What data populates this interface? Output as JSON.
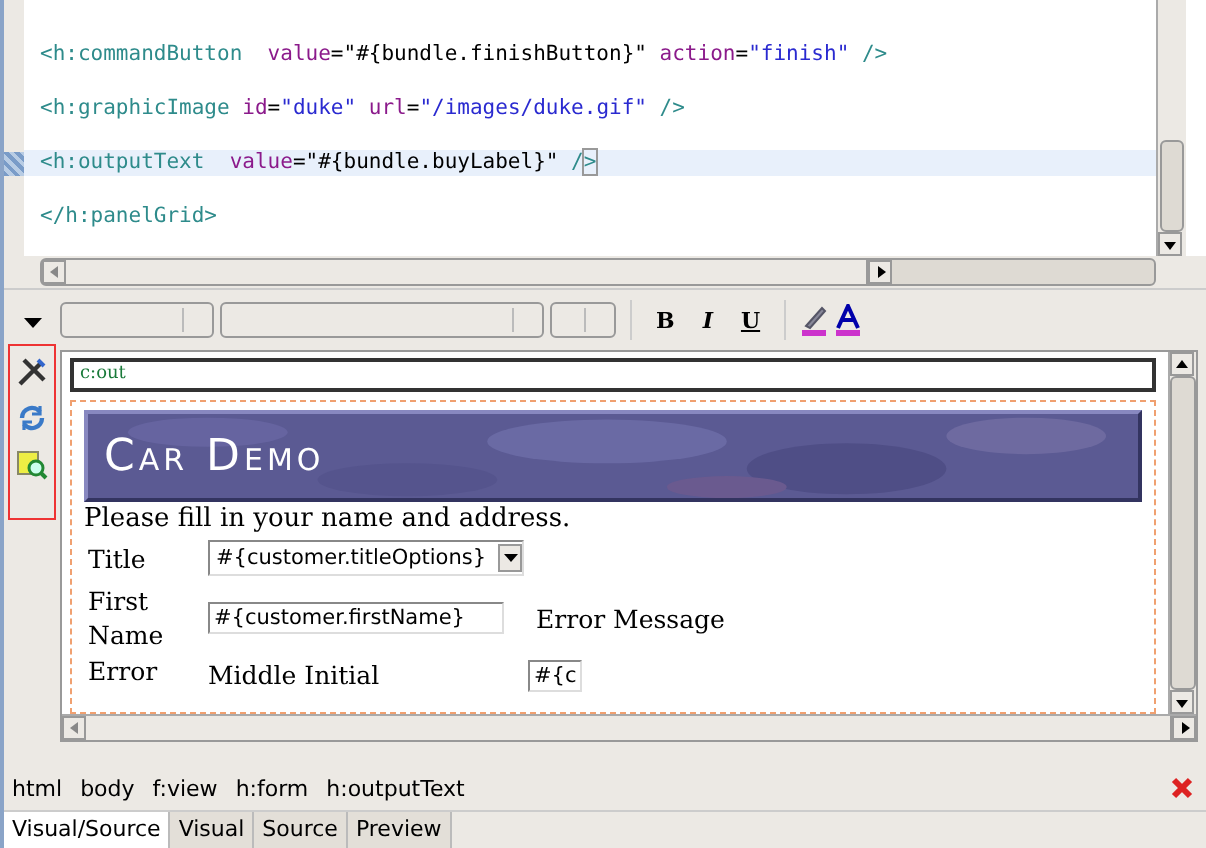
{
  "editor": {
    "lines": [
      {
        "current": false,
        "tokens": [
          {
            "kind": "tag",
            "text": "<h:commandButton"
          },
          {
            "kind": "attr",
            "text": "  value"
          },
          {
            "kind": "punct",
            "text": "="
          },
          {
            "kind": "el",
            "text": "\"#{bundle.finishButton}\""
          },
          {
            "kind": "attr",
            "text": " action"
          },
          {
            "kind": "punct",
            "text": "="
          },
          {
            "kind": "string",
            "text": "\"finish\""
          },
          {
            "kind": "tag",
            "text": " />"
          }
        ]
      },
      {
        "current": false,
        "tokens": [
          {
            "kind": "tag",
            "text": "<h:graphicImage"
          },
          {
            "kind": "attr",
            "text": " id"
          },
          {
            "kind": "punct",
            "text": "="
          },
          {
            "kind": "string",
            "text": "\"duke\""
          },
          {
            "kind": "attr",
            "text": " url"
          },
          {
            "kind": "punct",
            "text": "="
          },
          {
            "kind": "string",
            "text": "\"/images/duke.gif\""
          },
          {
            "kind": "tag",
            "text": " />"
          }
        ]
      },
      {
        "current": true,
        "tokens": [
          {
            "kind": "tag",
            "text": "<h:outputText"
          },
          {
            "kind": "attr",
            "text": "  value"
          },
          {
            "kind": "punct",
            "text": "="
          },
          {
            "kind": "el",
            "text": "\"#{bundle.buyLabel}\""
          },
          {
            "kind": "tag",
            "text": " /"
          },
          {
            "kind": "matched",
            "text": ">"
          }
        ]
      },
      {
        "current": false,
        "tokens": [
          {
            "kind": "tag",
            "text": "</h:panelGrid>"
          }
        ]
      }
    ]
  },
  "toolbar": {
    "buttons": [
      {
        "kind": "bold",
        "text": "B"
      },
      {
        "kind": "italic",
        "text": "I"
      },
      {
        "kind": "underline",
        "text": "U"
      }
    ]
  },
  "visual": {
    "component_label": "c:out",
    "banner": "Car Demo",
    "intro": "Please fill in your name and address.",
    "rows": [
      {
        "kind": "select",
        "label": "Title",
        "value": "#{customer.titleOptions}"
      },
      {
        "kind": "input",
        "label": "First Name",
        "value": "#{customer.firstName}",
        "message": "Error Message"
      },
      {
        "kind": "cut",
        "label": "Error",
        "label_2": "Middle Initial",
        "value": "#{c"
      }
    ]
  },
  "breadcrumb": [
    "html",
    "body",
    "f:view",
    "h:form",
    "h:outputText"
  ],
  "tabs": [
    {
      "label": "Visual/Source",
      "selected": true
    },
    {
      "label": "Visual",
      "selected": false
    },
    {
      "label": "Source",
      "selected": false
    },
    {
      "label": "Preview",
      "selected": false
    }
  ]
}
